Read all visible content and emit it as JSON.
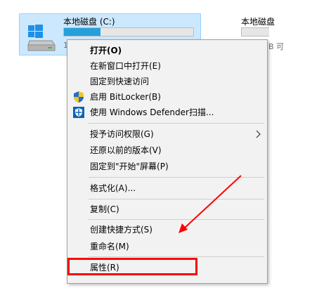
{
  "drives": {
    "c": {
      "name": "本地磁盘 (C:)",
      "usage_fraction": 0.28,
      "free_fragment": "1"
    },
    "second": {
      "name": "本地磁盘",
      "free_fragment": "B 可"
    }
  },
  "context_menu": {
    "items": [
      {
        "label": "打开(O)",
        "bold": true
      },
      {
        "label": "在新窗口中打开(E)"
      },
      {
        "label": "固定到快速访问"
      },
      {
        "label": "启用 BitLocker(B)",
        "icon": "shield-icon"
      },
      {
        "label": "使用 Windows Defender扫描...",
        "icon": "windows-defender-icon"
      },
      {
        "label": "授予访问权限(G)",
        "submenu": true
      },
      {
        "label": "还原以前的版本(V)"
      },
      {
        "label": "固定到\"开始\"屏幕(P)"
      },
      {
        "label": "格式化(A)..."
      },
      {
        "label": "复制(C)"
      },
      {
        "label": "创建快捷方式(S)"
      },
      {
        "label": "重命名(M)"
      },
      {
        "label": "属性(R)"
      }
    ]
  },
  "colors": {
    "selection_bg": "#cce8ff",
    "usage_fill": "#26a0da",
    "annotation": "#ff0000",
    "menu_bg": "#f2f2f2"
  }
}
